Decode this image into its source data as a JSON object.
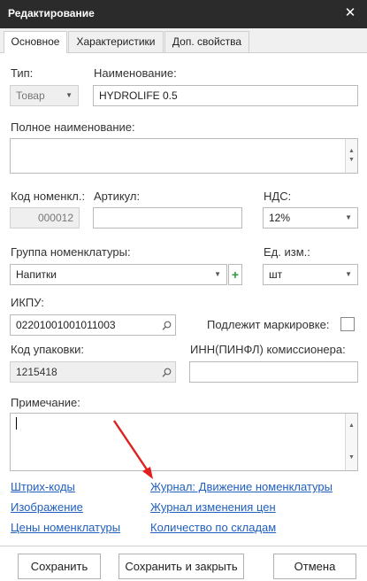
{
  "window": {
    "title": "Редактирование",
    "close": "✕"
  },
  "tabs": [
    "Основное",
    "Характеристики",
    "Доп. свойства"
  ],
  "fields": {
    "type_label": "Тип:",
    "type_value": "Товар",
    "name_label": "Наименование:",
    "name_value": "HYDROLIFE 0.5",
    "fullname_label": "Полное наименование:",
    "fullname_value": "",
    "code_label": "Код номенкл.:",
    "code_value": "000012",
    "article_label": "Артикул:",
    "article_value": "",
    "vat_label": "НДС:",
    "vat_value": "12%",
    "group_label": "Группа номенклатуры:",
    "group_value": "Напитки",
    "unit_label": "Ед. изм.:",
    "unit_value": "шт",
    "ikpu_label": "ИКПУ:",
    "ikpu_value": "02201001001011003",
    "marking_label": "Подлежит маркировке:",
    "pack_label": "Код упаковки:",
    "pack_value": "1215418",
    "inn_label": "ИНН(ПИНФЛ) комиссионера:",
    "inn_value": "",
    "note_label": "Примечание:",
    "note_value": ""
  },
  "links": {
    "barcodes": "Штрих-коды",
    "journal_movement": "Журнал: Движение номенклатуры",
    "image": "Изображение",
    "price_journal": "Журнал изменения цен",
    "prices": "Цены номенклатуры",
    "warehouse_qty": "Количество по складам"
  },
  "buttons": {
    "save": "Сохранить",
    "save_close": "Сохранить и закрыть",
    "cancel": "Отмена"
  },
  "colors": {
    "titlebar": "#2b2b2b",
    "link": "#1f5fbf",
    "arrow": "#e02020",
    "add": "#2e9e3e"
  }
}
